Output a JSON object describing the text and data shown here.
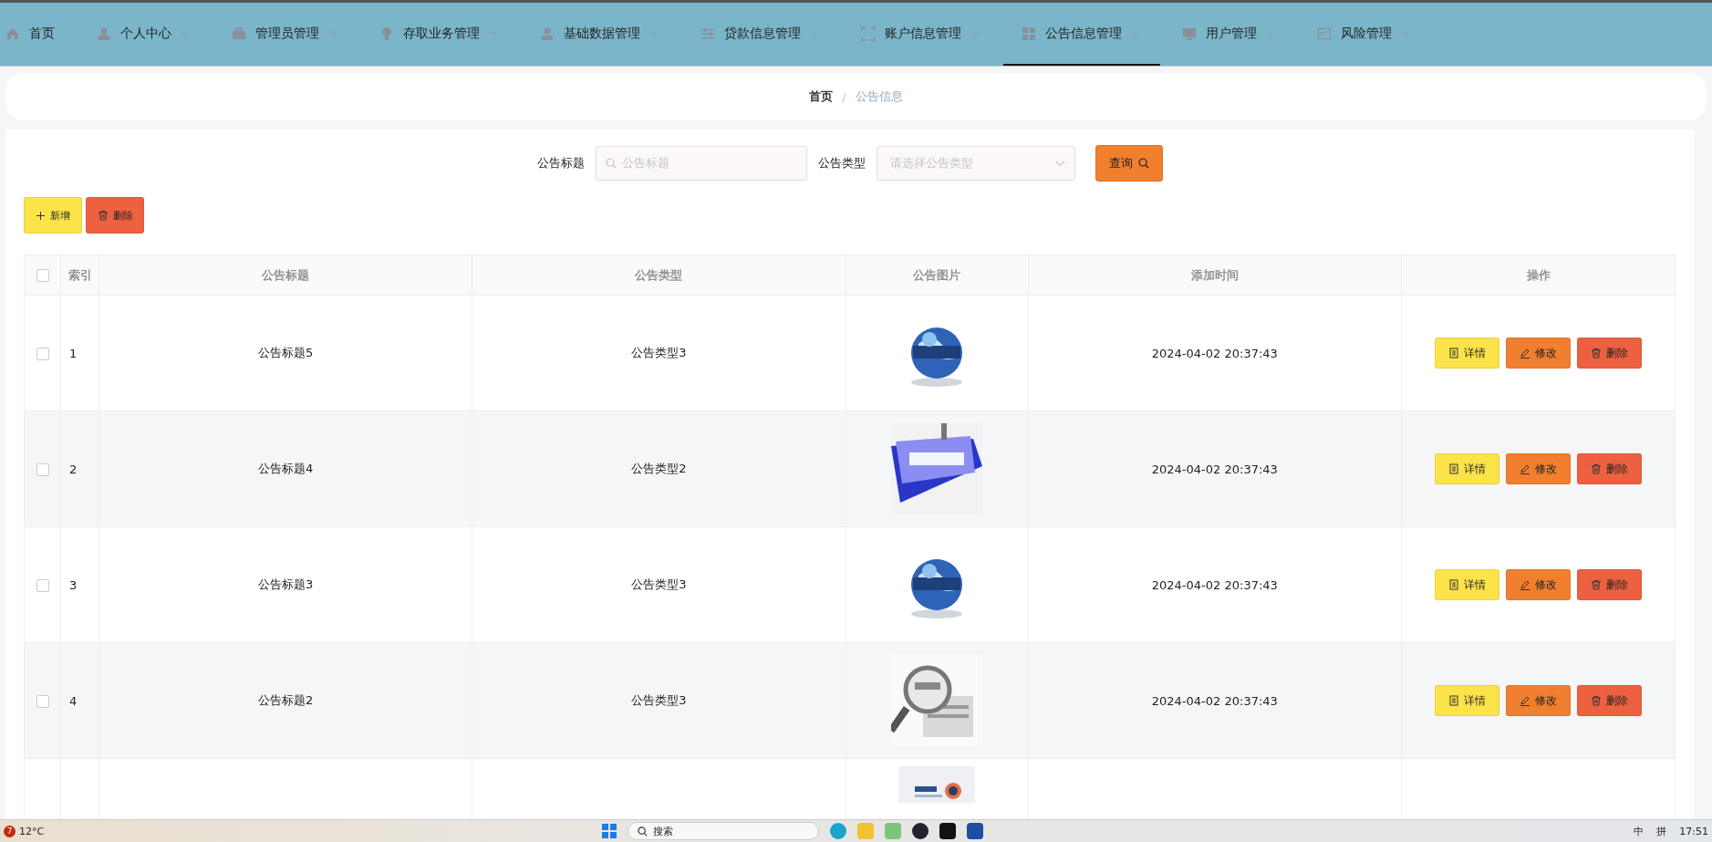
{
  "nav": {
    "items": [
      {
        "label": "首页",
        "dropdown": false,
        "selected": false
      },
      {
        "label": "个人中心",
        "dropdown": true,
        "selected": false
      },
      {
        "label": "管理员管理",
        "dropdown": true,
        "selected": false
      },
      {
        "label": "存取业务管理",
        "dropdown": true,
        "selected": false
      },
      {
        "label": "基础数据管理",
        "dropdown": true,
        "selected": false
      },
      {
        "label": "贷款信息管理",
        "dropdown": true,
        "selected": false
      },
      {
        "label": "账户信息管理",
        "dropdown": true,
        "selected": false
      },
      {
        "label": "公告信息管理",
        "dropdown": true,
        "selected": true
      },
      {
        "label": "用户管理",
        "dropdown": true,
        "selected": false
      },
      {
        "label": "风险管理",
        "dropdown": true,
        "selected": false
      }
    ]
  },
  "breadcrumb": {
    "items": [
      "首页",
      "公告信息"
    ],
    "separator": "/"
  },
  "search": {
    "fields": [
      {
        "label": "公告标题",
        "kind": "text",
        "placeholder": "公告标题"
      },
      {
        "label": "公告类型",
        "kind": "select",
        "placeholder": "请选择公告类型"
      }
    ],
    "button": "查询"
  },
  "toolbar": [
    {
      "label": "新增",
      "kind": "add"
    },
    {
      "label": "删除",
      "kind": "delete"
    }
  ],
  "table": {
    "header_checked": false,
    "columns": [
      "索引",
      "公告标题",
      "公告类型",
      "公告图片",
      "添加时间",
      "操作"
    ],
    "rows": [
      {
        "checked": false,
        "index": "1",
        "title": "公告标题5",
        "type": "公告类型3",
        "image": {
          "kind": "picture"
        },
        "time": "2024-04-02 20:37:43",
        "actions": [
          {
            "label": "详情",
            "kind": "detail"
          },
          {
            "label": "修改",
            "kind": "edit"
          },
          {
            "label": "删除",
            "kind": "delete"
          }
        ]
      },
      {
        "checked": false,
        "index": "2",
        "title": "公告标题4",
        "type": "公告类型2",
        "image": {
          "kind": "picture"
        },
        "time": "2024-04-02 20:37:43",
        "actions": [
          {
            "label": "详情",
            "kind": "detail"
          },
          {
            "label": "修改",
            "kind": "edit"
          },
          {
            "label": "删除",
            "kind": "delete"
          }
        ]
      },
      {
        "checked": false,
        "index": "3",
        "title": "公告标题3",
        "type": "公告类型3",
        "image": {
          "kind": "picture"
        },
        "time": "2024-04-02 20:37:43",
        "actions": [
          {
            "label": "详情",
            "kind": "detail"
          },
          {
            "label": "修改",
            "kind": "edit"
          },
          {
            "label": "删除",
            "kind": "delete"
          }
        ]
      },
      {
        "checked": false,
        "index": "4",
        "title": "公告标题2",
        "type": "公告类型3",
        "image": {
          "kind": "picture"
        },
        "time": "2024-04-02 20:37:43",
        "actions": [
          {
            "label": "详情",
            "kind": "detail"
          },
          {
            "label": "修改",
            "kind": "edit"
          },
          {
            "label": "删除",
            "kind": "delete"
          }
        ]
      },
      {
        "image": {
          "kind": "picture"
        }
      }
    ]
  },
  "taskbar": {
    "badge": "7",
    "weather": "12°C",
    "search": "搜索",
    "ime": [
      "中",
      "拼"
    ],
    "time": "17:51"
  }
}
